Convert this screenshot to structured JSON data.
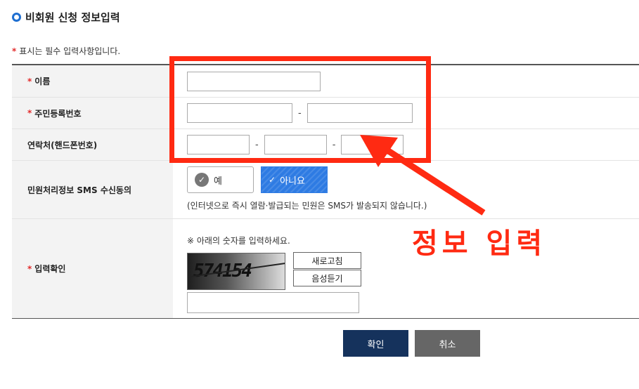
{
  "section_title": "비회원 신청 정보입력",
  "required_note": "표시는 필수 입력사항입니다.",
  "star": "*",
  "fields": {
    "name_label": "이름",
    "rrn_label": "주민등록번호",
    "phone_label": "연락처(핸드폰번호)",
    "sms_label": "민원처리정보 SMS 수신동의",
    "captcha_label": "입력확인"
  },
  "dash": "-",
  "sms": {
    "yes_label": "예",
    "no_label": "아니요",
    "note": "(인터넷으로 즉시 열람·발급되는 민원은 SMS가 발송되지 않습니다.)"
  },
  "captcha": {
    "note": "※ 아래의 숫자를 입력하세요.",
    "image_text": "574154",
    "refresh_label": "새로고침",
    "audio_label": "음성듣기"
  },
  "buttons": {
    "confirm_label": "확인",
    "cancel_label": "취소"
  },
  "annotation": {
    "text": "정보 입력",
    "color": "#ff2a12"
  },
  "colors": {
    "accent_blue": "#2e7be3",
    "confirm_navy": "#15325c",
    "required_red": "#e32b2b"
  }
}
